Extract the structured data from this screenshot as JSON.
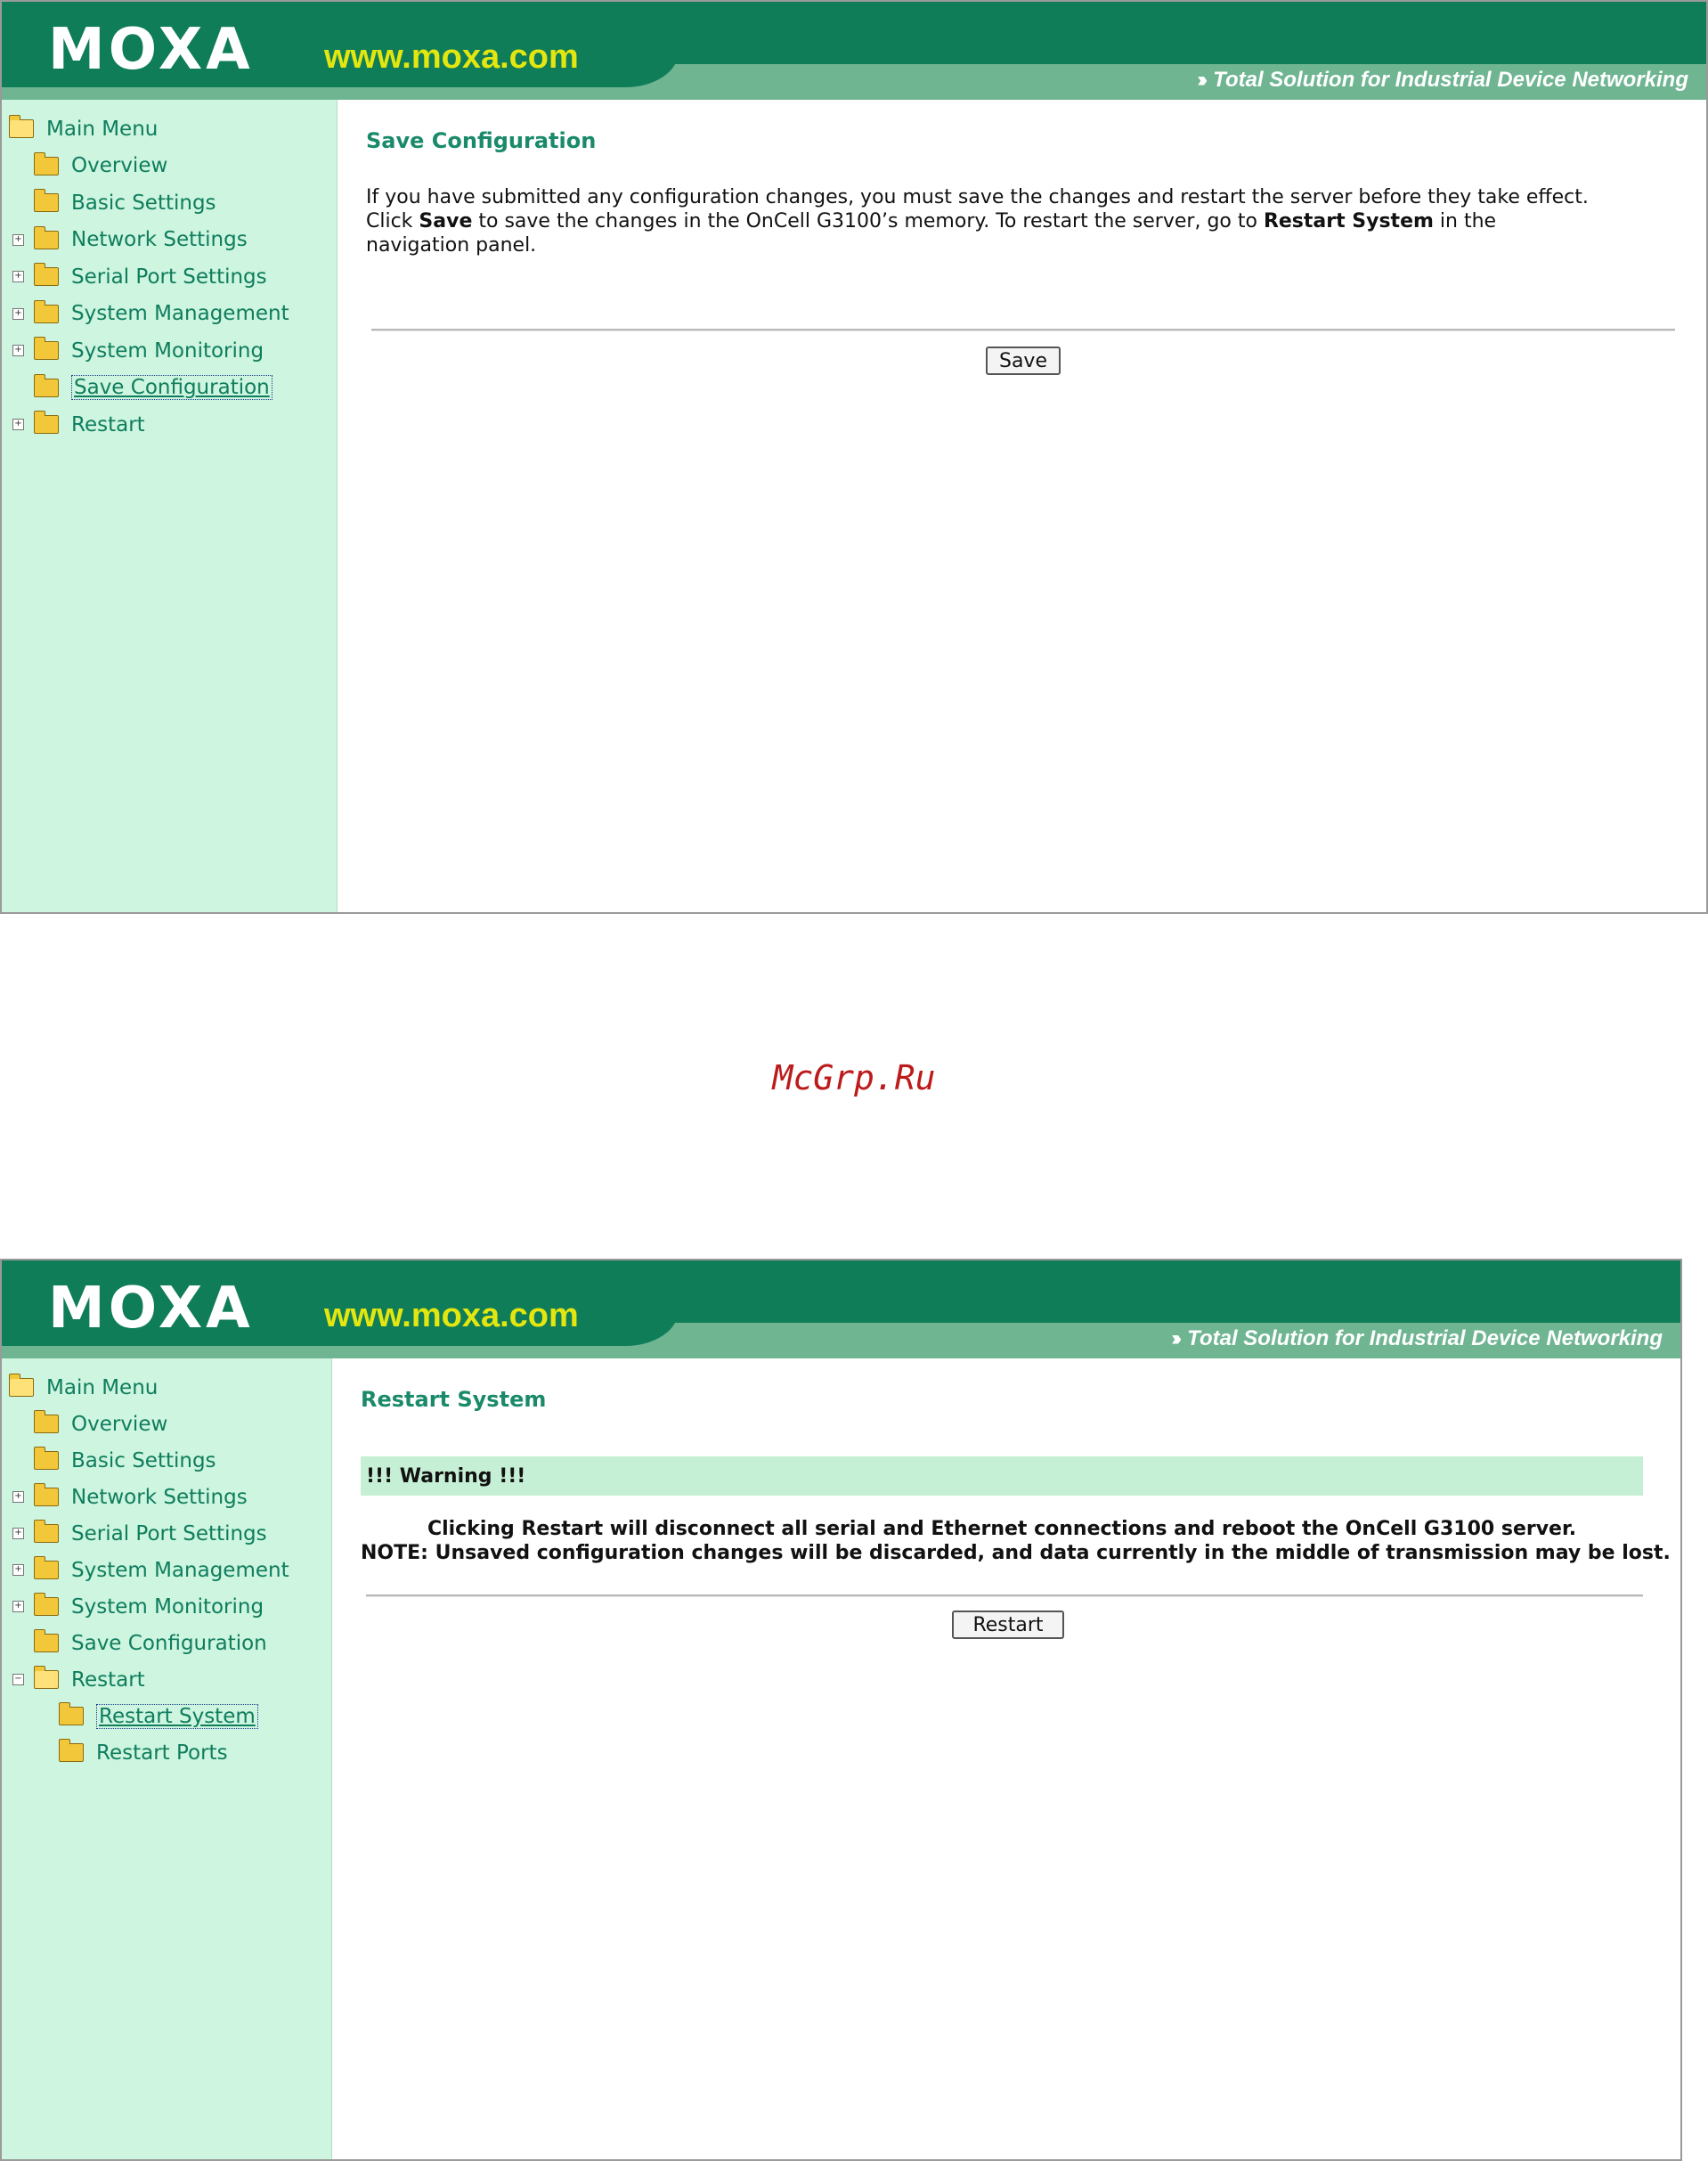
{
  "brand": {
    "logo": "MOXA",
    "site": "www.moxa.com",
    "tagline": "Total Solution for Industrial Device Networking",
    "accent": "#0f7d58",
    "site_color": "#e3e60f"
  },
  "save_screen": {
    "menu": [
      {
        "label": "Main Menu",
        "icon": "folder-icon"
      },
      {
        "label": "Overview",
        "icon": "folder-icon"
      },
      {
        "label": "Basic Settings",
        "icon": "folder-icon"
      },
      {
        "label": "Network Settings",
        "icon": "folder-icon"
      },
      {
        "label": "Serial Port Settings",
        "icon": "folder-icon"
      },
      {
        "label": "System Management",
        "icon": "folder-icon"
      },
      {
        "label": "System Monitoring",
        "icon": "folder-icon"
      },
      {
        "label": "Save Configuration",
        "icon": "folder-icon"
      },
      {
        "label": "Restart",
        "icon": "folder-icon"
      }
    ],
    "title": "Save Configuration",
    "p1": "If you have submitted any configuration changes, you must save the changes and restart the server before they take effect.",
    "p2a": "Click ",
    "p2b": "Save",
    "p2c": " to save the changes in the OnCell G3100’s memory. To restart the server, go to ",
    "p2d": "Restart System",
    "p2e": " in the",
    "p3": "navigation panel.",
    "button": "Save"
  },
  "watermark": "McGrp.Ru",
  "restart_screen": {
    "menu": [
      {
        "label": "Main Menu",
        "icon": "folder-icon"
      },
      {
        "label": "Overview",
        "icon": "folder-icon"
      },
      {
        "label": "Basic Settings",
        "icon": "folder-icon"
      },
      {
        "label": "Network Settings",
        "icon": "folder-icon"
      },
      {
        "label": "Serial Port Settings",
        "icon": "folder-icon"
      },
      {
        "label": "System Management",
        "icon": "folder-icon"
      },
      {
        "label": "System Monitoring",
        "icon": "folder-icon"
      },
      {
        "label": "Save Configuration",
        "icon": "folder-icon"
      },
      {
        "label": "Restart",
        "icon": "folder-icon"
      },
      {
        "label": "Restart System",
        "icon": "folder-icon"
      },
      {
        "label": "Restart Ports",
        "icon": "folder-icon"
      }
    ],
    "title": "Restart System",
    "warning": "!!! Warning !!!",
    "line1": "Clicking Restart will disconnect all serial and Ethernet connections and reboot the OnCell G3100 server.",
    "line2": "NOTE: Unsaved configuration changes will be discarded, and data currently in the middle of transmission may be lost.",
    "button": "Restart"
  }
}
